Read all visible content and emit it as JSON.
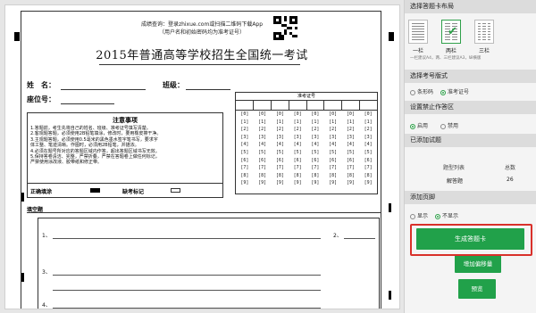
{
  "paper": {
    "instruction_line1": "成绩查询：登录zhixue.com或扫描二维码下载App",
    "instruction_line2": "（用户名和初始密码均为准考证号）",
    "title": "2015年普通高等学校招生全国统一考试",
    "name_label": "姓　名：",
    "class_label": "班级：",
    "seat_label": "座位号：",
    "exam_no_title": "准考证号",
    "exam_digits": [
      "[0]",
      "[1]",
      "[2]",
      "[3]",
      "[4]",
      "[5]",
      "[6]",
      "[7]",
      "[8]",
      "[9]"
    ],
    "notice_title": "注意事项",
    "notice_lines": [
      "1.答题前，考生先将自己的姓名、班级、准考证号填写清楚。",
      "2.客观题答题，必须使用2B铅笔填涂，修改时，要用橡皮擦干净。",
      "3.主观题答题，必须使用0.5毫米的黑色墨水签字笔书写，要求字",
      "体工整、笔迹清晰。作图时，必须用2B铅笔，并描浓。",
      "4.必须在题号所对应的答题区域内作答，超出答题区域书写无效。",
      "5.保持答卷清洁、完整，严禁折叠，严禁在答题卷上做任何标记，",
      "严禁使用涂改液、胶带纸和修正带。"
    ],
    "correct_fill_label": "正确填涂",
    "missing_mark_label": "缺考标记",
    "fill_section_label": "填空题",
    "q1": "1、",
    "q2": "2、",
    "q3": "3、",
    "q4": "4、"
  },
  "panel": {
    "layout_header": "选择答题卡布局",
    "layouts": [
      {
        "label": "一栏",
        "selected": false
      },
      {
        "label": "两栏",
        "selected": true
      },
      {
        "label": "三栏",
        "selected": false
      }
    ],
    "layout_subtext": "一栏建议A4，两、三栏建议A3，纵横版",
    "code_header": "选择考号版式",
    "code_options": [
      "条形码",
      "准考证号"
    ],
    "code_selected": "准考证号",
    "forbid_header": "设置禁止作答区",
    "forbid_options": [
      "启用",
      "禁用"
    ],
    "forbid_selected": "启用",
    "added_header": "已添加试题",
    "table_col1": "题型列表",
    "table_col2": "总数",
    "table_row_name": "解答题",
    "table_row_count": "26",
    "footer_header": "添加页脚",
    "footer_options": [
      "显示",
      "不显示"
    ],
    "footer_selected": "不显示",
    "generate_button": "生成答题卡",
    "add_offset_button": "增加偏移量",
    "preview_button": "预览"
  }
}
